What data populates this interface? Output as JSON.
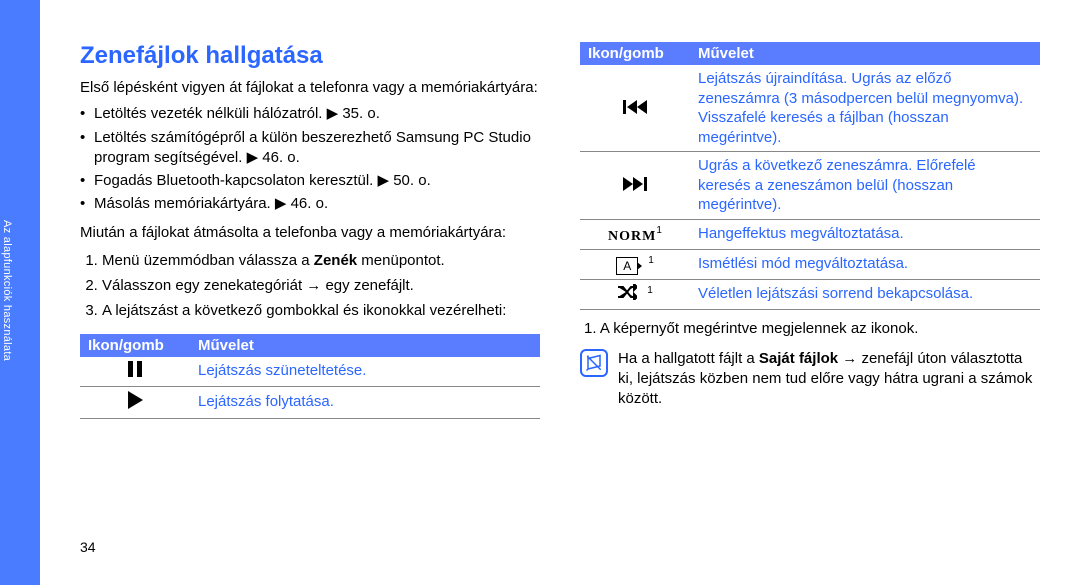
{
  "sidebar_label": "Az alapfunkciók használata",
  "page_number": "34",
  "left": {
    "title": "Zenefájlok hallgatása",
    "intro": "Első lépésként vigyen át fájlokat a telefonra vagy a memóriakártyára:",
    "bullets": [
      "Letöltés vezeték nélküli hálózatról. ▶ 35. o.",
      "Letöltés számítógépről a külön beszerezhető Samsung PC Studio program segítségével. ▶ 46. o.",
      "Fogadás Bluetooth-kapcsolaton keresztül. ▶ 50. o.",
      "Másolás memóriakártyára. ▶ 46. o."
    ],
    "after": "Miután a fájlokat átmásolta a telefonba vagy a memóriakártyára:",
    "steps": {
      "s1_pre": "Menü üzemmódban válassza a ",
      "s1_bold": "Zenék",
      "s1_post": " menüpontot.",
      "s2": "Válasszon egy zenekategóriát → egy zenefájlt.",
      "s3": "A lejátszást a következő gombokkal és ikonokkal vezérelheti:"
    },
    "table": {
      "h1": "Ikon/gomb",
      "h2": "Művelet",
      "rows": [
        {
          "icon": "pause",
          "desc": "Lejátszás szüneteltetése."
        },
        {
          "icon": "play",
          "desc": "Lejátszás folytatása."
        }
      ]
    }
  },
  "right": {
    "table": {
      "h1": "Ikon/gomb",
      "h2": "Művelet",
      "rows": [
        {
          "icon": "prev",
          "desc": "Lejátszás újraindítása. Ugrás az előző zeneszámra (3 másodpercen belül megnyomva). Visszafelé keresés a fájlban (hosszan megérintve)."
        },
        {
          "icon": "next",
          "desc": "Ugrás a következő zeneszámra. Előrefelé keresés a zeneszámon belül (hosszan megérintve)."
        },
        {
          "icon": "norm",
          "sup": "1",
          "desc": "Hangeffektus megváltoztatása."
        },
        {
          "icon": "repeat",
          "sup": "1",
          "desc": "Ismétlési mód megváltoztatása."
        },
        {
          "icon": "shuffle",
          "sup": "1",
          "desc": "Véletlen lejátszási sorrend bekapcsolása."
        }
      ]
    },
    "footnote": "1. A képernyőt megérintve megjelennek az ikonok.",
    "note_pre": "Ha a hallgatott fájlt a ",
    "note_bold": "Saját fájlok",
    "note_post": " → zenefájl úton választotta ki, lejátszás közben nem tud előre vagy hátra ugrani a számok között."
  }
}
